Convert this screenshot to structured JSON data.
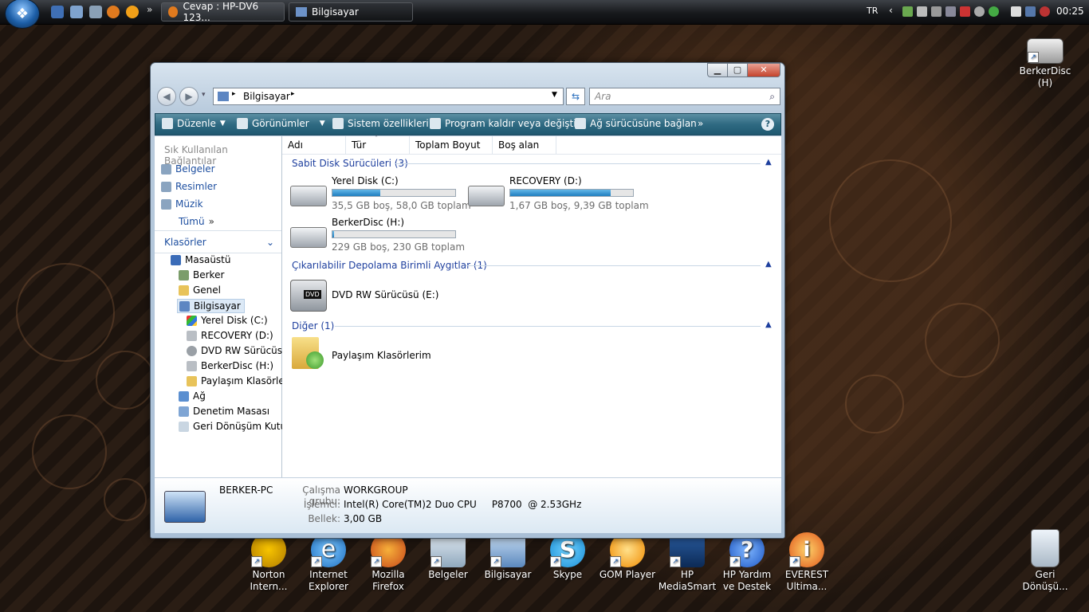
{
  "taskbar": {
    "start_label": "Start",
    "tasks": [
      "Cevap : HP-DV6 123...",
      "Bilgisayar"
    ],
    "lang": "TR",
    "clock": "00:25"
  },
  "window": {
    "title": "Bilgisayar",
    "breadcrumb": "Bilgisayar",
    "search_placeholder": "Ara",
    "toolbar": {
      "organize": "Düzenle",
      "views": "Görünümler",
      "system_properties": "Sistem özellikleri",
      "uninstall": "Program kaldır veya değiştir",
      "map_drive": "Ağ sürücüsüne bağlan",
      "more": "»",
      "help": "?"
    },
    "favorites": {
      "header": "Sık Kullanılan Bağlantılar",
      "items": [
        "Belgeler",
        "Resimler",
        "Müzik"
      ],
      "more": "Tümü"
    },
    "folders": {
      "header": "Klasörler",
      "items": [
        "Masaüstü",
        "Berker",
        "Genel",
        "Bilgisayar",
        "Yerel Disk (C:)",
        "RECOVERY (D:)",
        "DVD RW Sürücüsü",
        "BerkerDisc (H:)",
        "Paylaşım Klasörler",
        "Ağ",
        "Denetim Masası",
        "Geri Dönüşüm Kutu"
      ]
    },
    "columns": [
      "Adı",
      "Tür",
      "Toplam Boyut",
      "Boş alan"
    ],
    "groups": {
      "hdd": "Sabit Disk Sürücüleri (3)",
      "removable": "Çıkarılabilir Depolama Birimli Aygıtlar (1)",
      "other": "Diğer (1)"
    },
    "drives": [
      {
        "name": "Yerel Disk (C:)",
        "info": "35,5 GB boş, 58,0 GB toplam",
        "used_fraction": 0.39
      },
      {
        "name": "RECOVERY (D:)",
        "info": "1,67 GB boş, 9,39 GB toplam",
        "used_fraction": 0.82
      },
      {
        "name": "BerkerDisc (H:)",
        "info": "229 GB boş, 230 GB toplam",
        "used_fraction": 0.01
      }
    ],
    "dvd": {
      "name": "DVD RW Sürücüsü (E:)",
      "badge": "DVD"
    },
    "shared": {
      "name": "Paylaşım Klasörlerim"
    },
    "details": {
      "pc_name": "BERKER-PC",
      "workgroup_label": "Çalışma grubu:",
      "workgroup": "WORKGROUP",
      "cpu_label": "İşlemci:",
      "cpu": "Intel(R) Core(TM)2 Duo CPU     P8700  @ 2.53GHz",
      "ram_label": "Bellek:",
      "ram": "3,00 GB"
    }
  },
  "desktop_icons": [
    {
      "label": "Norton Intern..."
    },
    {
      "label": "Internet Explorer"
    },
    {
      "label": "Mozilla Firefox"
    },
    {
      "label": "Belgeler"
    },
    {
      "label": "Bilgisayar"
    },
    {
      "label": "Skype"
    },
    {
      "label": "GOM Player"
    },
    {
      "label": "HP MediaSmart"
    },
    {
      "label": "HP Yardım ve Destek"
    },
    {
      "label": "EVEREST Ultima..."
    },
    {
      "label": "BerkerDisc (H)"
    },
    {
      "label": "Geri Dönüşü..."
    }
  ]
}
